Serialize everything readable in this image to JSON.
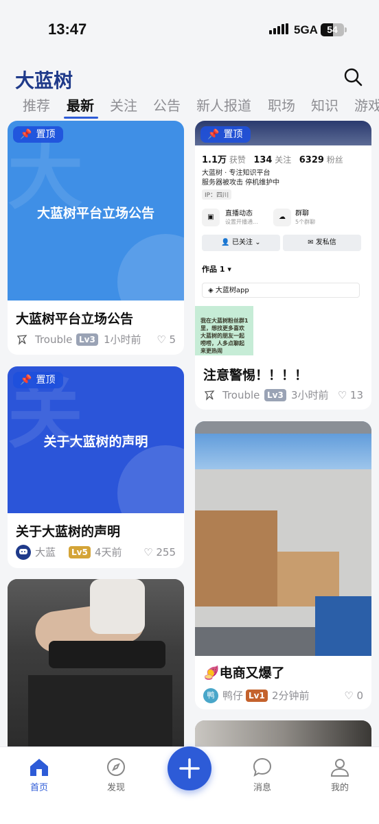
{
  "status_bar": {
    "time": "13:47",
    "network": "5GA",
    "battery": "54",
    "battery_level": 0.54
  },
  "header": {
    "title": "大蓝树"
  },
  "tabs": [
    {
      "label": "推荐"
    },
    {
      "label": "最新"
    },
    {
      "label": "关注"
    },
    {
      "label": "公告"
    },
    {
      "label": "新人报道"
    },
    {
      "label": "职场"
    },
    {
      "label": "知识"
    },
    {
      "label": "游戏"
    }
  ],
  "active_tab": "最新",
  "pin_label": "置顶",
  "posts": [
    {
      "cover_text": "大蓝树平台立场公告",
      "cover_bg_char": "大",
      "title": "大蓝树平台立场公告",
      "author": "Trouble",
      "level": "Lv3",
      "time": "1小时前",
      "likes": "5",
      "pinned": true
    },
    {
      "cover_text": "关于大蓝树的声明",
      "cover_bg_char": "关",
      "title": "关于大蓝树的声明",
      "author": "大蓝",
      "level": "Lv5",
      "time": "4天前",
      "likes": "255",
      "pinned": true
    },
    {
      "title": "",
      "author": "",
      "level": "",
      "time": "",
      "likes": ""
    },
    {
      "title": "注意警惕！！！！",
      "author": "Trouble",
      "level": "Lv3",
      "time": "3小时前",
      "likes": "13",
      "pinned": true,
      "profile_cover": {
        "stats": [
          {
            "value": "1.1万",
            "label": "获赞"
          },
          {
            "value": "134",
            "label": "关注"
          },
          {
            "value": "6329",
            "label": "粉丝"
          }
        ],
        "bio": [
          "大蓝树 · 专注知识平台",
          "服务器被攻击 停机维护中"
        ],
        "ip": "IP：四川",
        "features": [
          {
            "title": "直播动态",
            "sub": "设置开播通..."
          },
          {
            "title": "群聊",
            "sub": "5个群聊"
          }
        ],
        "follow_btn": "已关注",
        "message_btn": "发私信",
        "works_label": "作品 1",
        "collection": "大蓝树app",
        "thumb_text": "我在大蓝树粉丝群1里，想找更多喜欢大蓝树的朋友一起唠唠，人多点聊起来更热闹"
      }
    },
    {
      "title": "电商又爆了",
      "title_emoji": "🍠",
      "author": "鸭仔",
      "avatar_char": "鸭",
      "level": "Lv1",
      "time": "2分钟前",
      "likes": "0"
    }
  ],
  "bottom_nav": [
    {
      "label": "首页"
    },
    {
      "label": "发现"
    },
    {
      "label": "消息"
    },
    {
      "label": "我的"
    }
  ],
  "colors": {
    "accent": "#2d5bd7",
    "brand_title": "#1f3a8a",
    "card1_bg": "#3f8fe6",
    "card2_bg": "#2b55d9"
  }
}
